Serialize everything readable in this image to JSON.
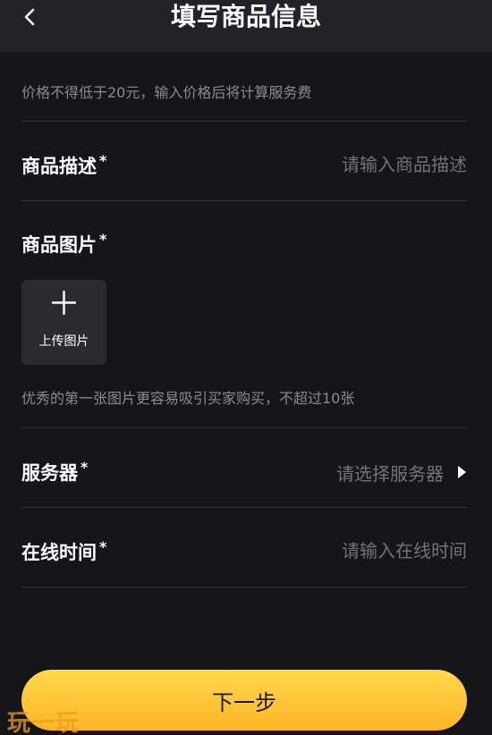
{
  "header": {
    "title": "填写商品信息"
  },
  "price_hint": "价格不得低于20元，输入价格后将计算服务费",
  "description": {
    "label": "商品描述",
    "required_mark": "*",
    "placeholder": "请输入商品描述",
    "value": ""
  },
  "images": {
    "label": "商品图片",
    "required_mark": "*",
    "upload_label": "上传图片",
    "hint": "优秀的第一张图片更容易吸引买家购买，不超过10张"
  },
  "server": {
    "label": "服务器",
    "required_mark": "*",
    "placeholder": "请选择服务器"
  },
  "online_time": {
    "label": "在线时间",
    "required_mark": "*",
    "placeholder": "请输入在线时间",
    "value": ""
  },
  "next_button": {
    "label": "下一步"
  },
  "watermark": "玩一玩",
  "colors": {
    "background": "#161519",
    "header": "#232228",
    "accent_start": "#ffd84d",
    "accent_end": "#ffb526",
    "hint_text": "#8a8a90"
  }
}
